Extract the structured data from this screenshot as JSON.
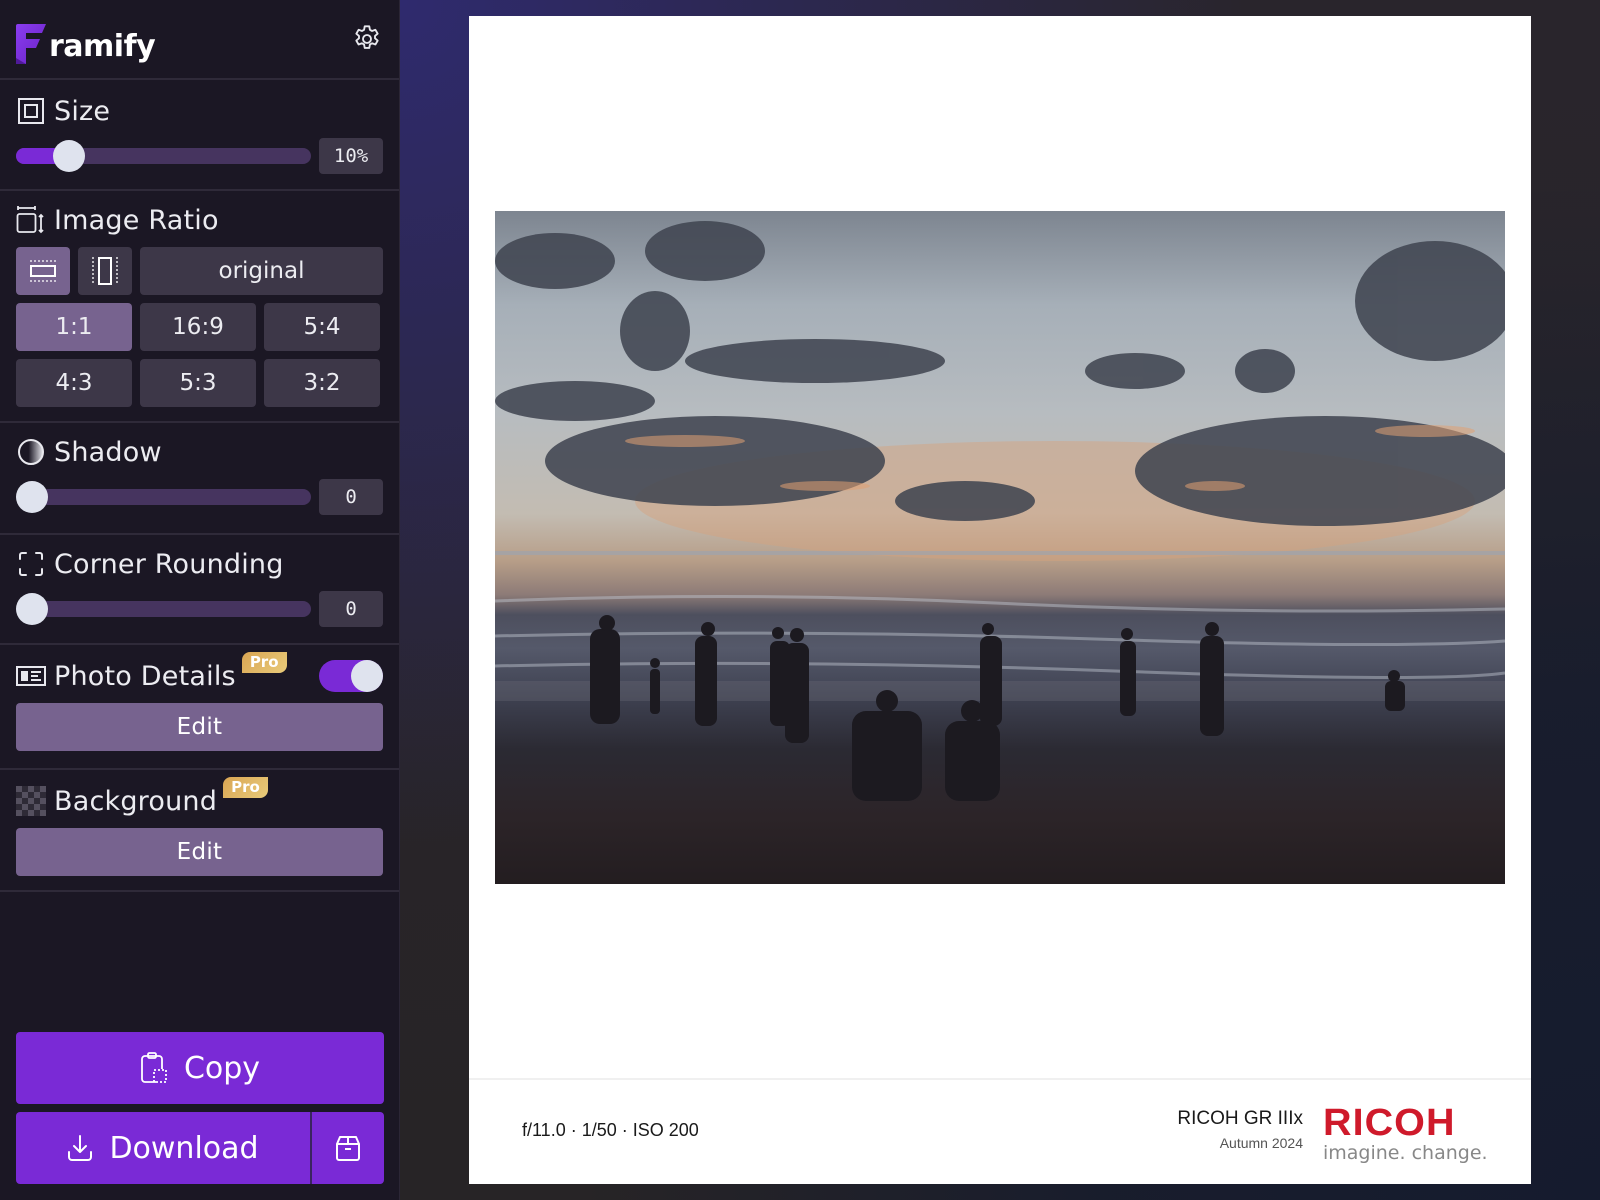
{
  "app": {
    "name_rest": "ramify",
    "brand_color": "#7a2ad6"
  },
  "header": {
    "settings_icon": "gear-icon"
  },
  "size": {
    "title": "Size",
    "icon": "frame-square-icon",
    "value_label": "10%",
    "value_fraction": 0.14
  },
  "ratio": {
    "title": "Image Ratio",
    "icon": "resize-box-icon",
    "orientation": [
      {
        "name": "landscape",
        "icon": "landscape-icon",
        "active": true
      },
      {
        "name": "portrait",
        "icon": "portrait-icon",
        "active": false
      }
    ],
    "original_label": "original",
    "options": [
      {
        "label": "1:1",
        "active": true
      },
      {
        "label": "16:9",
        "active": false
      },
      {
        "label": "5:4",
        "active": false
      },
      {
        "label": "4:3",
        "active": false
      },
      {
        "label": "5:3",
        "active": false
      },
      {
        "label": "3:2",
        "active": false
      }
    ]
  },
  "shadow": {
    "title": "Shadow",
    "icon": "half-circle-icon",
    "value_label": "0",
    "value_fraction": 0
  },
  "corner": {
    "title": "Corner Rounding",
    "icon": "corners-icon",
    "value_label": "0",
    "value_fraction": 0
  },
  "photo_details": {
    "title": "Photo Details",
    "icon": "id-card-icon",
    "badge": "Pro",
    "enabled": true,
    "edit_label": "Edit"
  },
  "background": {
    "title": "Background",
    "icon": "checkerboard-icon",
    "badge": "Pro",
    "edit_label": "Edit"
  },
  "actions": {
    "copy_label": "Copy",
    "download_label": "Download"
  },
  "canvas": {
    "exif": "f/11.0 · 1/50 · ISO 200",
    "camera_model": "RICOH GR IIIx",
    "camera_subtitle": "Autumn 2024",
    "brand_name": "RICOH",
    "brand_tagline": "imagine. change.",
    "brand_color": "#cf1a2b"
  }
}
